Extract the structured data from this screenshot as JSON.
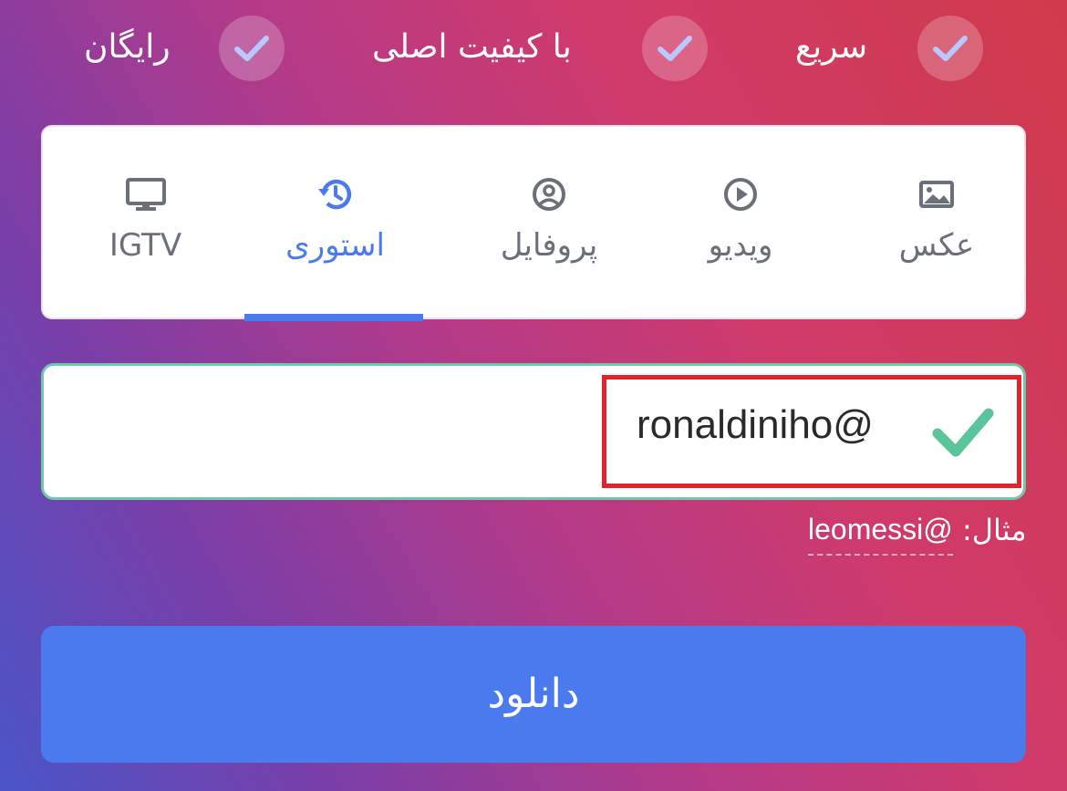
{
  "features": [
    {
      "label": "سریع"
    },
    {
      "label": "با کیفیت اصلی"
    },
    {
      "label": "رایگان"
    }
  ],
  "tabs": [
    {
      "label": "عکس",
      "icon": "image-icon",
      "active": false
    },
    {
      "label": "ویدیو",
      "icon": "play-circle-icon",
      "active": false
    },
    {
      "label": "پروفایل",
      "icon": "profile-icon",
      "active": false
    },
    {
      "label": "استوری",
      "icon": "history-icon",
      "active": true
    },
    {
      "label": "IGTV",
      "icon": "tv-icon",
      "active": false
    }
  ],
  "input": {
    "value": "ronaldiniho@",
    "valid": true
  },
  "hint": {
    "prefix": "مثال:",
    "example": "leomessi@"
  },
  "download_button": {
    "label": "دانلود"
  },
  "colors": {
    "accent": "#4b79ee",
    "valid": "#5ac49a",
    "highlight": "#e0242b"
  }
}
